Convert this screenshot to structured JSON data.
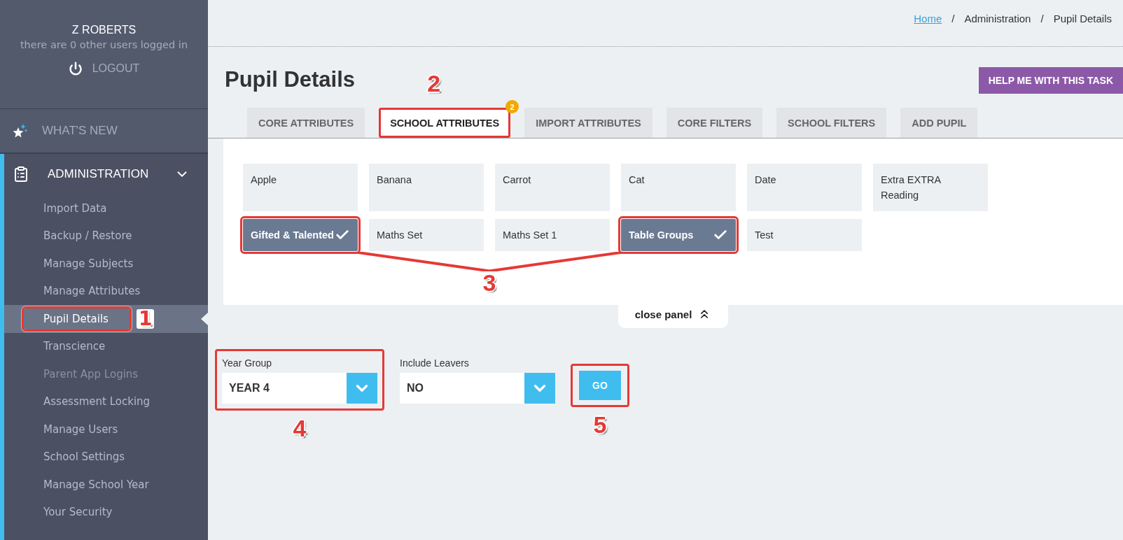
{
  "user": {
    "name": "Z ROBERTS",
    "status": "there are 0 other users logged in",
    "logout": "LOGOUT"
  },
  "sidebar": {
    "items": [
      {
        "label": "WHAT'S NEW",
        "kind": "link"
      },
      {
        "label": "ADMINISTRATION",
        "kind": "section",
        "expanded": true,
        "children": [
          {
            "label": "Import Data",
            "selected": false,
            "disabled": false
          },
          {
            "label": "Backup / Restore",
            "selected": false,
            "disabled": false
          },
          {
            "label": "Manage Subjects",
            "selected": false,
            "disabled": false
          },
          {
            "label": "Manage Attributes",
            "selected": false,
            "disabled": false
          },
          {
            "label": "Pupil Details",
            "selected": true,
            "disabled": false,
            "annotation": "1"
          },
          {
            "label": "Transcience",
            "selected": false,
            "disabled": false
          },
          {
            "label": "Parent App Logins",
            "selected": false,
            "disabled": true
          },
          {
            "label": "Assessment Locking",
            "selected": false,
            "disabled": false
          },
          {
            "label": "Manage Users",
            "selected": false,
            "disabled": false
          },
          {
            "label": "School Settings",
            "selected": false,
            "disabled": false
          },
          {
            "label": "Manage School Year",
            "selected": false,
            "disabled": false
          },
          {
            "label": "Your Security",
            "selected": false,
            "disabled": false
          }
        ]
      }
    ]
  },
  "breadcrumb": {
    "separator": "/",
    "items": [
      {
        "label": "Home",
        "link": true
      },
      {
        "label": "Administration",
        "link": false
      },
      {
        "label": "Pupil Details",
        "link": false
      }
    ]
  },
  "title": "Pupil Details",
  "help_button": "HELP ME WITH THIS TASK",
  "tabs": [
    {
      "label": "CORE ATTRIBUTES",
      "selected": false
    },
    {
      "label": "SCHOOL ATTRIBUTES",
      "selected": true,
      "badge": "2",
      "annotation": "2"
    },
    {
      "label": "IMPORT ATTRIBUTES",
      "selected": false
    },
    {
      "label": "CORE FILTERS",
      "selected": false
    },
    {
      "label": "SCHOOL FILTERS",
      "selected": false
    },
    {
      "label": "ADD PUPIL",
      "selected": false
    }
  ],
  "attributes": {
    "annotation": "3",
    "items": [
      {
        "label": "Apple",
        "selected": false
      },
      {
        "label": "Banana",
        "selected": false
      },
      {
        "label": "Carrot",
        "selected": false
      },
      {
        "label": "Cat",
        "selected": false
      },
      {
        "label": "Date",
        "selected": false
      },
      {
        "label": "Extra EXTRA Reading",
        "selected": false
      },
      {
        "label": "Gifted & Talented",
        "selected": true
      },
      {
        "label": "Maths Set",
        "selected": false
      },
      {
        "label": "Maths Set 1",
        "selected": false
      },
      {
        "label": "Table Groups",
        "selected": true
      },
      {
        "label": "Test",
        "selected": false
      }
    ]
  },
  "close_panel": "close panel",
  "filters": [
    {
      "label": "Year Group",
      "value": "YEAR 4",
      "annotation": "4"
    },
    {
      "label": "Include Leavers",
      "value": "NO"
    }
  ],
  "go_button": {
    "label": "GO",
    "annotation": "5"
  }
}
